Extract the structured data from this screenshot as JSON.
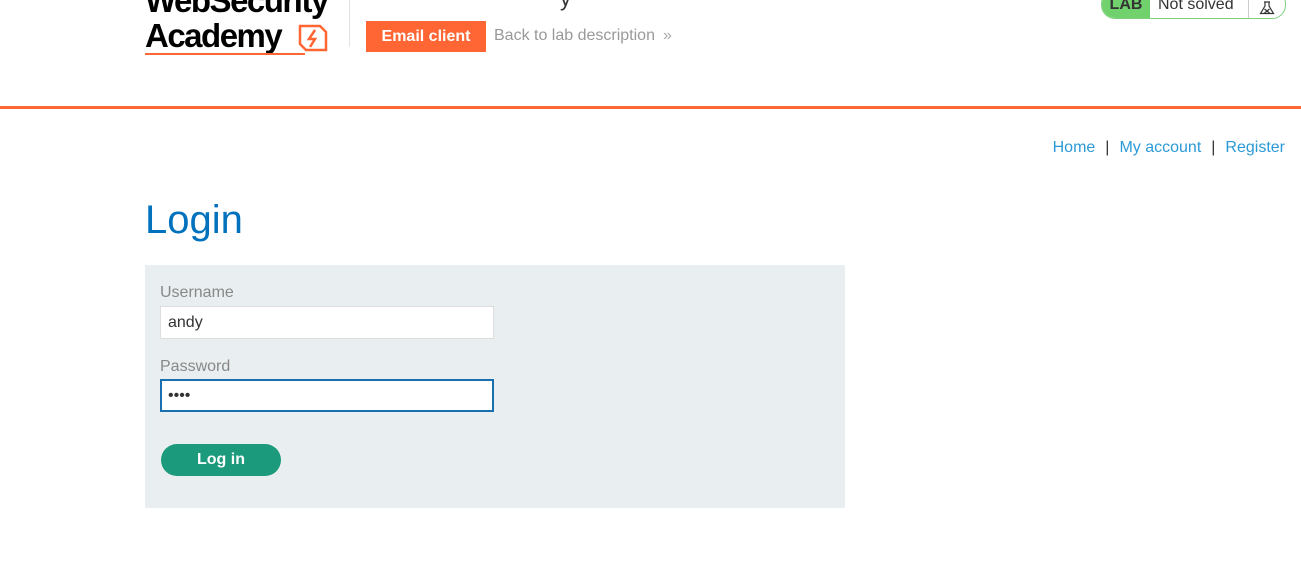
{
  "header": {
    "logo_line1": "WebSecurity",
    "logo_line2": "Academy",
    "lab_title_partial": "y",
    "email_client_label": "Email client",
    "back_link_label": "Back to lab description",
    "back_chevron": "»"
  },
  "status": {
    "lab_label": "LAB",
    "state": "Not solved"
  },
  "nav": {
    "home": "Home",
    "my_account": "My account",
    "register": "Register",
    "separator": "|"
  },
  "login": {
    "title": "Login",
    "username_label": "Username",
    "username_value": "andy",
    "password_label": "Password",
    "password_value": "••••",
    "submit_label": "Log in"
  },
  "colors": {
    "accent": "#ff6633",
    "link": "#2c9ad6",
    "title": "#0071bc",
    "form_bg": "#e9eef0",
    "button": "#1b9b7c",
    "status_green": "#70d16d"
  }
}
